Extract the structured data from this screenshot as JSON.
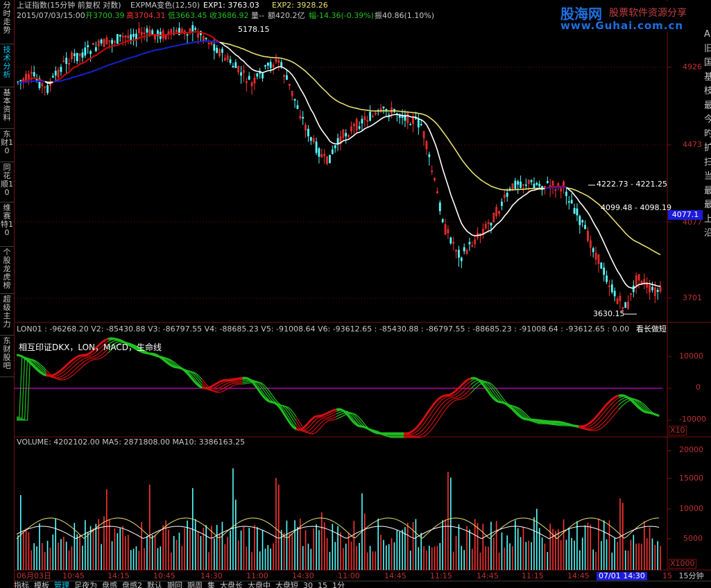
{
  "header": {
    "title": "上证指数(15分钟 前复权 对数)",
    "indicator": "EXPMA变色(12,50)",
    "exp1": "EXP1: 3763.03",
    "exp2": "EXP2: 3928.26",
    "datetime": "2015/07/03/15:00",
    "open": "开3700.39",
    "high": "高3704.31",
    "low": "低3663.45",
    "close": "收3686.92",
    "volume_text": "量--",
    "amount": "额420.2亿",
    "change": "幅-14.36(-0.39%)",
    "amplitude": "振40.86(1.10%)"
  },
  "brand": {
    "name": "股海网",
    "slogan": "股票软件资源分享",
    "url": "www.Guhai.com.cn"
  },
  "left_tabs": [
    {
      "label": "分时走势",
      "active": false
    },
    {
      "label": "技术分析",
      "active": true
    },
    {
      "label": "基本资料",
      "active": false
    },
    {
      "label": "东财10",
      "active": false
    },
    {
      "label": "同花顺10",
      "active": false
    },
    {
      "label": "维赛特10",
      "active": false
    },
    {
      "label": "个股龙虎榜",
      "active": false
    },
    {
      "label": "超级主力",
      "active": false
    },
    {
      "label": "东财股吧",
      "active": false
    }
  ],
  "right_panel_chars": [
    "A",
    "旧",
    "国",
    "基",
    "枝",
    "最",
    "今",
    "旳",
    "扩",
    "扫",
    "当",
    "最",
    "最",
    "上",
    "沿"
  ],
  "main_chart": {
    "price_ticks": [
      "4926",
      "4473",
      "4077",
      "3701"
    ],
    "current_price_tag": "4077.1",
    "annotations": {
      "peak": "5178.15",
      "range1": "4222.73 - 4221.25",
      "range2": "4099.48 - 4098.19",
      "low": "3630.15"
    }
  },
  "lon_panel": {
    "header": "LON01 : -96268.20  V2: -85430.88  V3: -86797.55  V4: -88685.23  V5: -91008.64  V6: -93612.65  : -85430.88  : -86797.55  : -88685.23  : -91008.64  : -93612.65  : 0.00",
    "right_label": "看长做短",
    "subtitle": "相互印证DKX，LON，MACD，生命线",
    "ticks": [
      "10000",
      "0",
      "-10000"
    ],
    "multiplier": "X10"
  },
  "volume_panel": {
    "header": "VOLUME: 4202102.00  MA5: 2871808.00  MA10: 3386163.25",
    "ticks": [
      "20000",
      "15000",
      "10000",
      "5000"
    ],
    "multiplier": "X1000"
  },
  "time_axis": {
    "labels": [
      "06月03日",
      "10:45",
      "14:15",
      "10:45",
      "14:30",
      "11:00",
      "14:30",
      "11:00",
      "14:45",
      "11:15",
      "14:45",
      "11:15",
      "14:45",
      "07/01 14:30",
      "15"
    ],
    "period": "15分钟"
  },
  "bottom_tabs": [
    {
      "label": "指标",
      "active": false
    },
    {
      "label": "模板",
      "active": false
    },
    {
      "label": "管理",
      "active": true
    },
    {
      "label": "足夜为",
      "active": false
    },
    {
      "label": "盘感",
      "active": false
    },
    {
      "label": "盘感2",
      "active": false
    },
    {
      "label": "默认",
      "active": false
    },
    {
      "label": "期回",
      "active": false
    },
    {
      "label": "期周",
      "active": false
    },
    {
      "label": "集",
      "active": false
    },
    {
      "label": "大盘长",
      "active": false
    },
    {
      "label": "大盘中",
      "active": false
    },
    {
      "label": "大盘短",
      "active": false
    },
    {
      "label": "30",
      "active": false
    },
    {
      "label": "15",
      "active": false
    },
    {
      "label": "1分",
      "active": false
    }
  ],
  "colors": {
    "up": "#ff3232",
    "down": "#54ffff",
    "exp_short": "#ffffff",
    "exp_long": "#e8e070",
    "exp_up": "#d00000",
    "exp_down": "#1020d0",
    "lon_up": "#d01010",
    "lon_down": "#20c020",
    "zero_line": "#d000d0",
    "grid": "#7a1010",
    "axis_text": "#c03030"
  }
}
